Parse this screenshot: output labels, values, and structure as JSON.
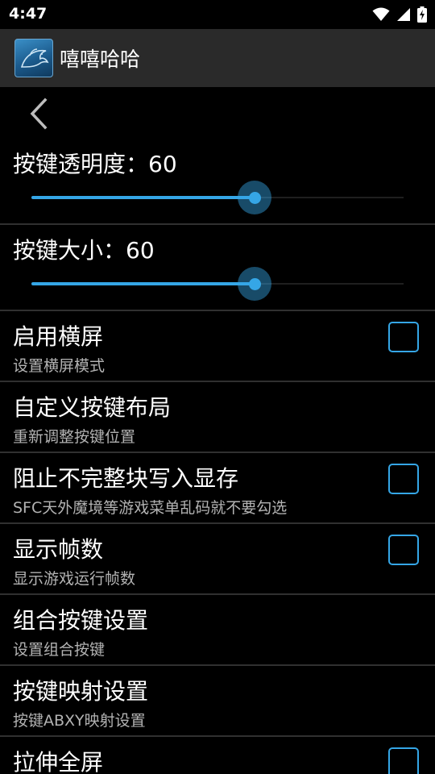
{
  "status_bar": {
    "time": "4:47",
    "icons": [
      "wifi-icon",
      "cell-signal-icon",
      "battery-charging-icon"
    ]
  },
  "app_bar": {
    "title": "嘻嘻哈哈",
    "icon": "dolphin-logo-icon"
  },
  "back": {
    "icon": "chevron-left-icon"
  },
  "seekbars": [
    {
      "label": "按键透明度：60",
      "value": 60,
      "max": 100
    },
    {
      "label": "按键大小：60",
      "value": 60,
      "max": 100
    }
  ],
  "preferences": [
    {
      "title": "启用横屏",
      "subtitle": "设置横屏模式",
      "has_checkbox": true,
      "checked": false
    },
    {
      "title": "自定义按键布局",
      "subtitle": "重新调整按键位置",
      "has_checkbox": false
    },
    {
      "title": "阻止不完整块写入显存",
      "subtitle": "SFC天外魔境等游戏菜单乱码就不要勾选",
      "has_checkbox": true,
      "checked": false
    },
    {
      "title": "显示帧数",
      "subtitle": "显示游戏运行帧数",
      "has_checkbox": true,
      "checked": false
    },
    {
      "title": "组合按键设置",
      "subtitle": "设置组合按键",
      "has_checkbox": false
    },
    {
      "title": "按键映射设置",
      "subtitle": "按键ABXY映射设置",
      "has_checkbox": false
    },
    {
      "title": "拉伸全屏",
      "subtitle": "",
      "has_checkbox": true,
      "checked": false
    }
  ],
  "colors": {
    "accent": "#35a6e6",
    "action_bar": "#2a2a2a",
    "background": "#000000",
    "divider": "#303030",
    "subtitle": "#b3b3b3"
  }
}
